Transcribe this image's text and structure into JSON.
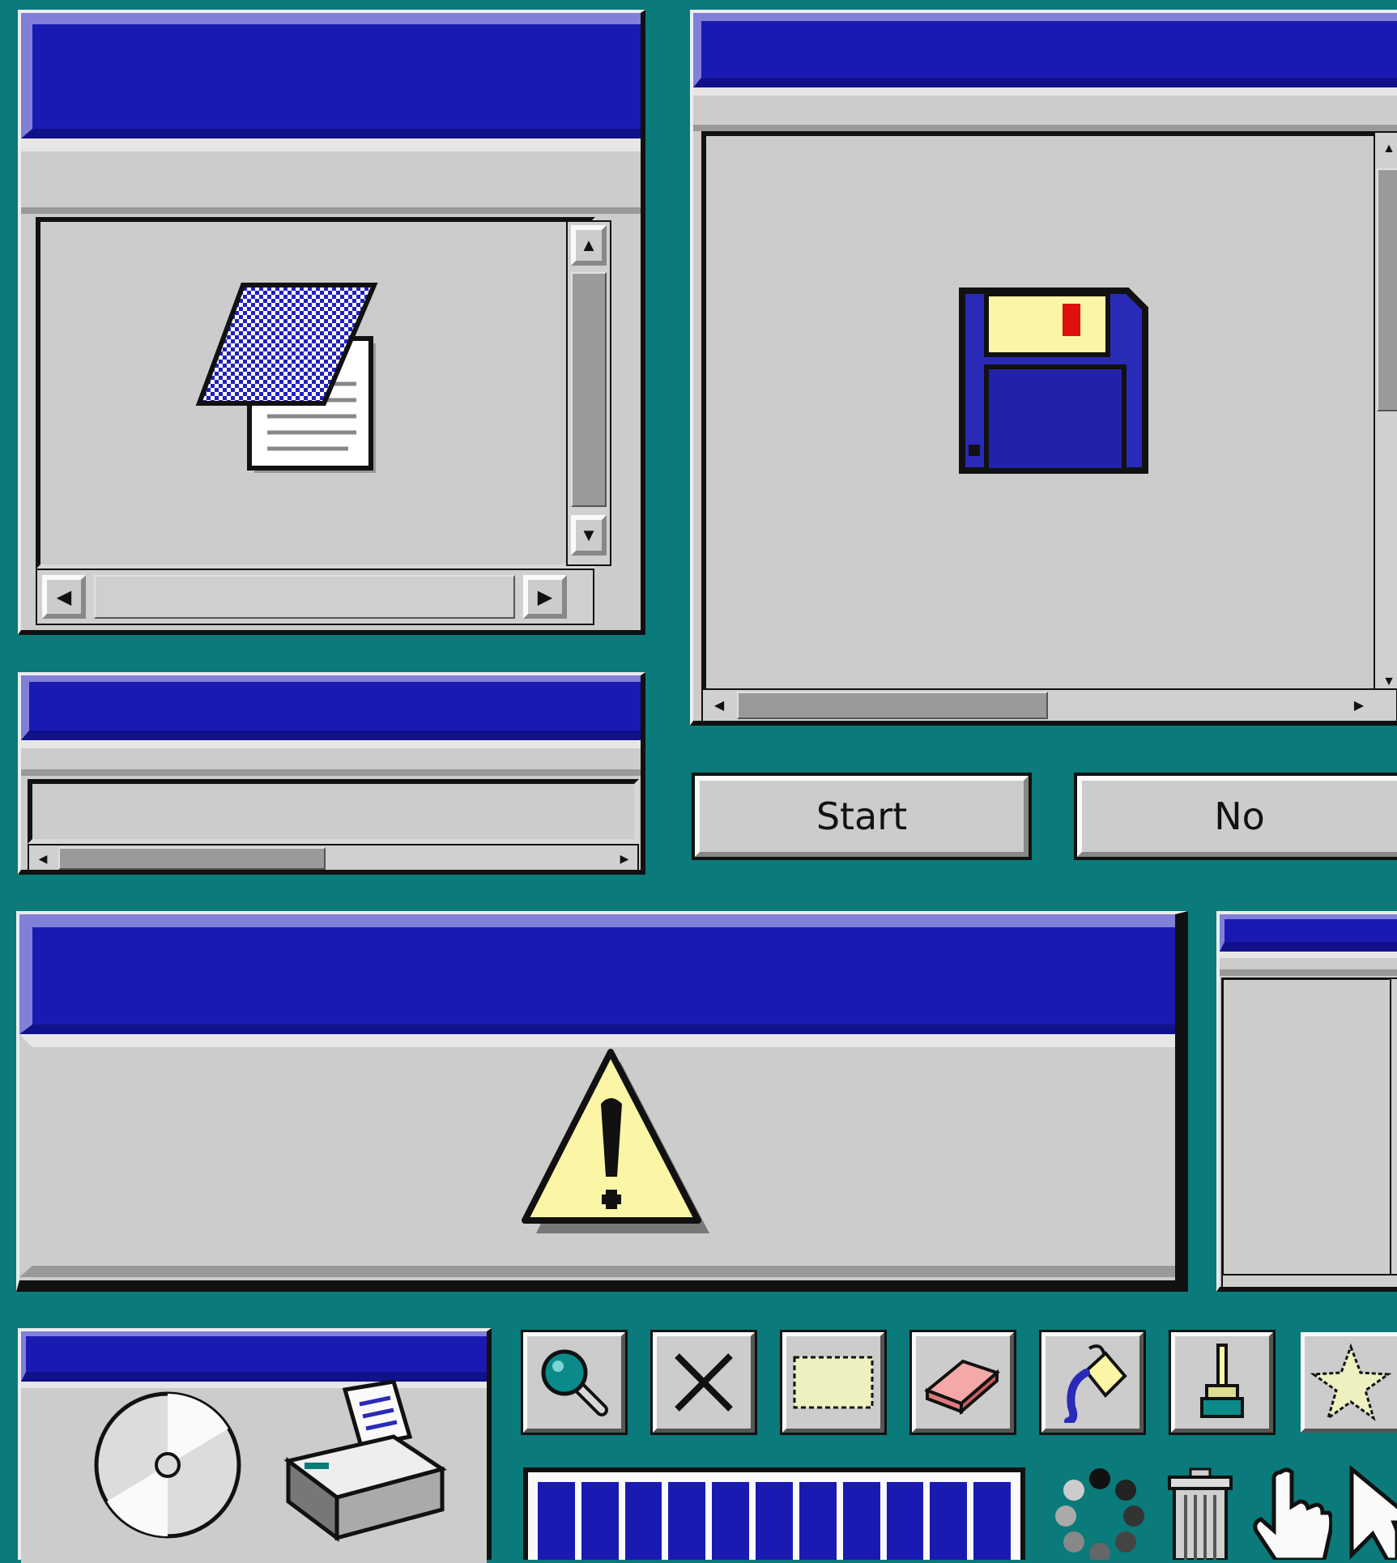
{
  "buttons": {
    "start_label": "Start",
    "no_label": "No"
  },
  "icons": [
    "notepad-icon",
    "floppy-disk-icon",
    "warning-icon",
    "cd-disc-icon",
    "printer-icon",
    "magnifier-icon",
    "close-x-icon",
    "selection-icon",
    "eraser-icon",
    "paint-bucket-icon",
    "brush-icon",
    "star-icon",
    "trash-icon",
    "hand-pointer-icon",
    "arrow-cursor-icon",
    "loading-spinner-icon"
  ],
  "progress": {
    "filled_segments": 11,
    "total_segments": 11
  },
  "colors": {
    "desktop": "#0a7a7a",
    "title_bar": "#1a1ab3",
    "window_face": "#cccccc",
    "warning_fill": "#fbf6a6"
  }
}
